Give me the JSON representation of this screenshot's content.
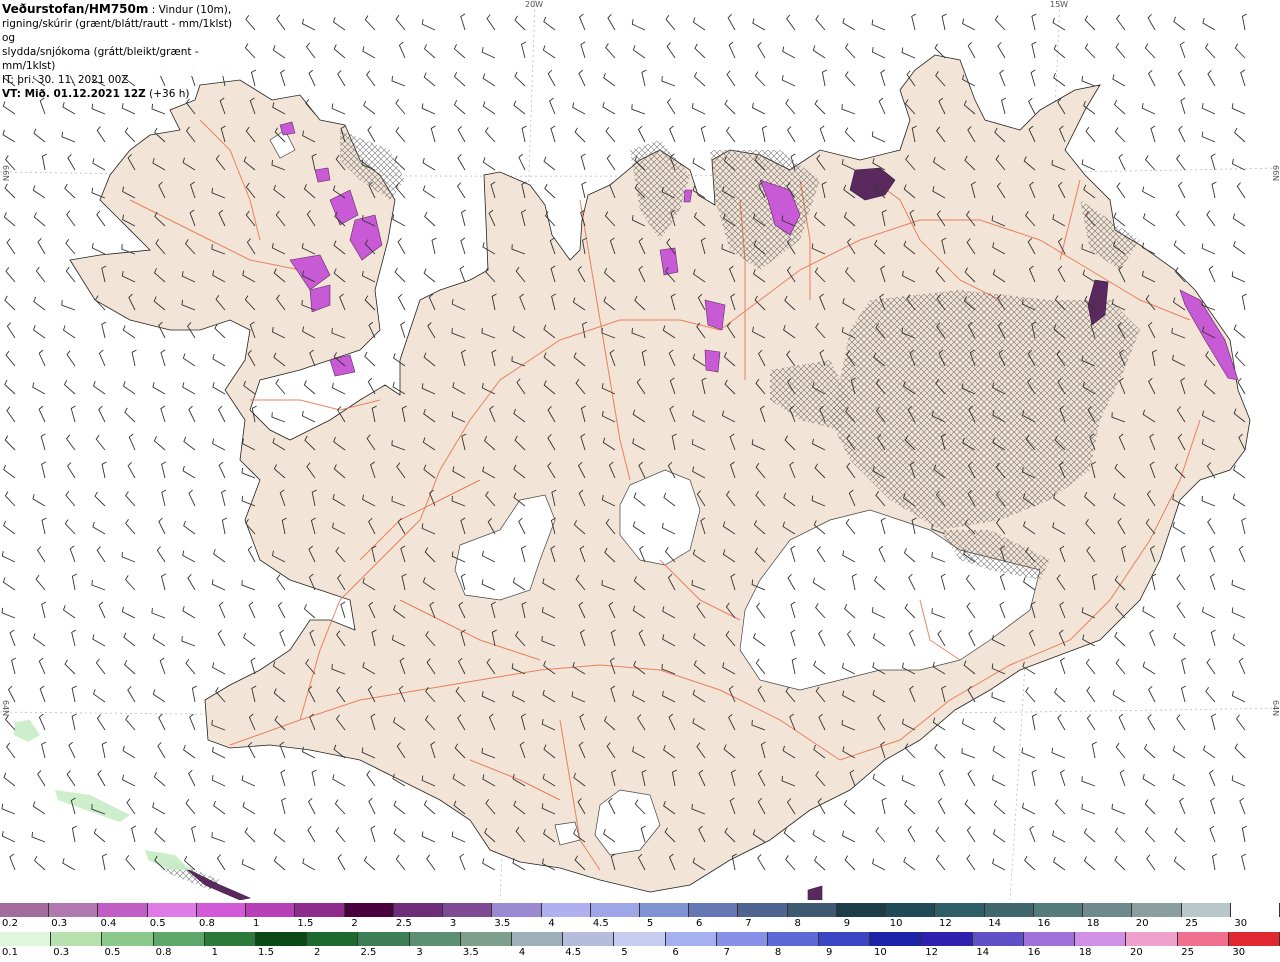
{
  "header": {
    "title": "Veðurstofan/HM750m",
    "desc1": " : Vindur (10m),",
    "desc2": "rigning/skúrir (grænt/blátt/rautt - mm/1klst) og",
    "desc3": "slydda/snjókoma (grátt/bleikt/grænt - mm/1klst)",
    "it": "IT: þri. 30. 11. 2021 00Z",
    "vt": "VT: Mið. 01.12.2021 12Z",
    "vt_offset": "(+36 h)"
  },
  "grid_labels": {
    "lon_20w": "20W",
    "lon_15w": "15W",
    "lat_66n_left": "66N",
    "lat_66n_right": "66N",
    "lat_64n_left": "64N",
    "lat_64n_right": "64N"
  },
  "colors": {
    "land": "#f2e4d6",
    "sea": "#ffffff",
    "glacier": "#ffffff",
    "roads": "#e8704a",
    "snow_accent": "#c95ad6",
    "snow_dark": "#5a2a5e"
  },
  "legend_snow": {
    "labels": [
      "0.2",
      "0.3",
      "0.4",
      "0.5",
      "0.8",
      "1",
      "1.5",
      "2",
      "2.5",
      "3",
      "3.5",
      "4",
      "4.5",
      "5",
      "6",
      "7",
      "8",
      "9",
      "10",
      "12",
      "14",
      "16",
      "18",
      "20",
      "25",
      "30"
    ],
    "colors": [
      "#a36a9e",
      "#b178b0",
      "#c15dc5",
      "#df7ae6",
      "#d259d8",
      "#b73fb8",
      "#8e2b8c",
      "#4a003f",
      "#6e2d79",
      "#7f4a94",
      "#9a8ad2",
      "#b0b0f0",
      "#9fa6e8",
      "#8094d4",
      "#6777b4",
      "#4d6590",
      "#3d5a72",
      "#1c3c48",
      "#1f4a56",
      "#2e5e66",
      "#40686c",
      "#557a7a",
      "#6e8a8c",
      "#8a9ea0",
      "#b8c8ca",
      "#ffffff"
    ]
  },
  "legend_rain": {
    "labels": [
      "0.1",
      "0.3",
      "0.5",
      "0.8",
      "1",
      "1.5",
      "2",
      "2.5",
      "3",
      "3.5",
      "4",
      "4.5",
      "5",
      "6",
      "7",
      "8",
      "9",
      "10",
      "12",
      "14",
      "16",
      "18",
      "20",
      "25",
      "30"
    ],
    "colors": [
      "#dff5dc",
      "#b7e2b0",
      "#8bc98a",
      "#5ea76a",
      "#2b7a3a",
      "#0b4a14",
      "#1e6a2e",
      "#3e7e54",
      "#5d8f72",
      "#7da08e",
      "#9db0ba",
      "#b4bedc",
      "#c7cdf0",
      "#a5b0ee",
      "#8590e6",
      "#5c6ad8",
      "#3a46c4",
      "#1a22a8",
      "#3020b0",
      "#6050c8",
      "#a070d8",
      "#d090e6",
      "#f0a0cc",
      "#f07090",
      "#e02830"
    ]
  }
}
